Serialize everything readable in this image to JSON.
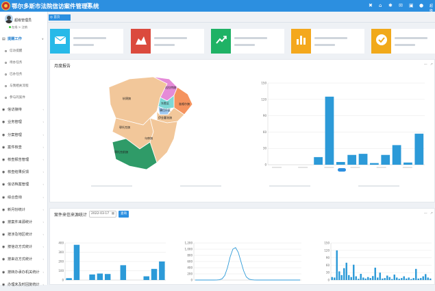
{
  "header": {
    "title": "鄂尔多斯市法院信访案件管理系统",
    "user": "超级"
  },
  "sidebar": {
    "user_name": "超级管理员",
    "status": "在线 > 注销",
    "items": [
      {
        "label": "提醒工作",
        "icon": "bell-icon",
        "active": true
      },
      {
        "label": "信访接待",
        "icon": "dot"
      },
      {
        "label": "业务管理",
        "icon": "dot"
      },
      {
        "label": "分案管理",
        "icon": "dot"
      },
      {
        "label": "案件核查",
        "icon": "dot"
      },
      {
        "label": "核查报告管理",
        "icon": "dot"
      },
      {
        "label": "核查结果反馈",
        "icon": "dot"
      },
      {
        "label": "信访档案管理",
        "icon": "dot"
      },
      {
        "label": "综合查询",
        "icon": "dot"
      },
      {
        "label": "新月份统计",
        "icon": "dot"
      },
      {
        "label": "按案件来源统计",
        "icon": "dot"
      },
      {
        "label": "按涉及地区统计",
        "icon": "dot"
      },
      {
        "label": "按信访方式统计",
        "icon": "dot"
      },
      {
        "label": "按来访方式统计",
        "icon": "dot"
      },
      {
        "label": "按转办承办机关统计",
        "icon": "dot"
      },
      {
        "label": "办理未及时回复统计",
        "icon": "dot"
      }
    ],
    "subitems": [
      "信访提醒",
      "待办任务",
      "已办任务",
      "与我相关流程",
      "参与的案件"
    ]
  },
  "breadcrumb": {
    "tab": "◎ 首页"
  },
  "stats": {
    "colors": [
      "#27b9e8",
      "#db4a3d",
      "#1fb265",
      "#f4a81d",
      "#f1a91a"
    ],
    "icons": [
      "mail-icon",
      "area-chart-icon",
      "trend-line-icon",
      "bar-chart-icon",
      "check-circle-icon"
    ]
  },
  "panels": {
    "monthly": "月度报告",
    "source": "案件来信来源统计",
    "date_value": "2022-03-17",
    "query": "查询"
  },
  "map": {
    "regions": [
      {
        "name": "杭锦旗",
        "color": "#f2c79a"
      },
      {
        "name": "达拉特旗",
        "color": "#e58bd8"
      },
      {
        "name": "东胜区",
        "color": "#7fd8d6"
      },
      {
        "name": "康巴什区",
        "color": "#9fc9f2"
      },
      {
        "name": "准格尔旗",
        "color": "#f5935e"
      },
      {
        "name": "伊金霍洛旗",
        "color": "#f2c79a"
      },
      {
        "name": "鄂托克旗",
        "color": "#f2c79a"
      },
      {
        "name": "乌审旗",
        "color": "#f2c79a"
      },
      {
        "name": "鄂托克前旗",
        "color": "#2f9b68"
      }
    ]
  },
  "chart_data": [
    {
      "type": "bar",
      "ylim": [
        0,
        150
      ],
      "yticks": [
        0,
        30,
        60,
        90,
        120,
        150
      ],
      "values": [
        0,
        0,
        0,
        0,
        14,
        125,
        5,
        18,
        20,
        3,
        18,
        36,
        4,
        57
      ],
      "color": "#2c9ad8",
      "legend": "dot-marker"
    },
    {
      "type": "bar",
      "ylim": [
        0,
        400
      ],
      "yticks": [
        0,
        100,
        200,
        300,
        400
      ],
      "values": [
        20,
        380,
        0,
        60,
        70,
        65,
        0,
        160,
        0,
        0,
        40,
        120,
        200
      ],
      "color": "#2c9ad8"
    },
    {
      "type": "line",
      "ylim": [
        0,
        1200
      ],
      "yticks": [
        0,
        200,
        400,
        600,
        800,
        1000,
        1200
      ],
      "values": [
        0,
        0,
        0,
        0,
        0,
        0,
        0,
        0,
        2,
        10,
        40,
        150,
        400,
        750,
        1000,
        1050,
        900,
        600,
        300,
        100,
        30,
        10,
        2,
        0,
        0,
        0,
        0,
        0,
        0,
        0,
        0,
        0,
        0,
        0,
        0,
        0,
        0,
        0,
        0,
        0
      ],
      "color": "#2c9ad8"
    },
    {
      "type": "bar",
      "ylim": [
        0,
        150
      ],
      "yticks": [
        0,
        30,
        60,
        90,
        120,
        150
      ],
      "values": [
        12,
        10,
        120,
        35,
        20,
        48,
        70,
        20,
        12,
        62,
        15,
        5,
        25,
        10,
        6,
        12,
        8,
        16,
        50,
        10,
        30,
        6,
        8,
        18,
        12,
        4,
        22,
        10,
        5,
        8,
        15,
        6,
        10,
        4,
        8,
        45,
        6,
        8,
        15,
        24,
        10,
        6
      ],
      "color": "#2c9ad8"
    }
  ]
}
